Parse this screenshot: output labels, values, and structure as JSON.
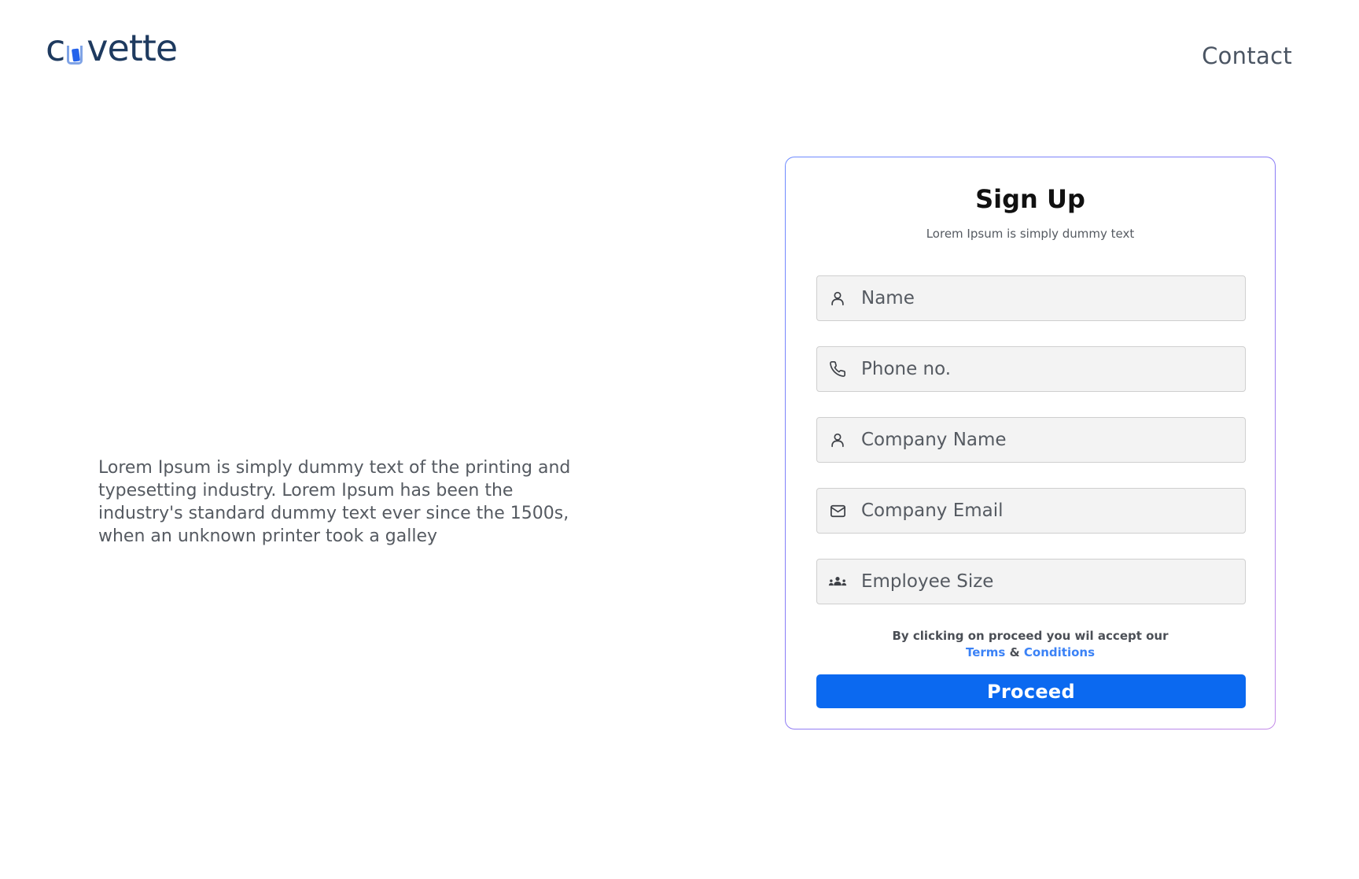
{
  "header": {
    "logo": {
      "prefix": "c",
      "suffix": "vette"
    },
    "nav_contact": "Contact"
  },
  "intro": {
    "text": "Lorem Ipsum is simply dummy text of the printing and typesetting industry. Lorem Ipsum has been the industry's standard dummy text ever since the 1500s, when an unknown printer took a galley"
  },
  "signup": {
    "title": "Sign Up",
    "subtitle": "Lorem Ipsum is simply dummy text",
    "fields": [
      {
        "placeholder": "Name",
        "icon": "user-icon"
      },
      {
        "placeholder": "Phone no.",
        "icon": "phone-icon"
      },
      {
        "placeholder": "Company Name",
        "icon": "user-icon"
      },
      {
        "placeholder": "Company Email",
        "icon": "mail-icon"
      },
      {
        "placeholder": "Employee Size",
        "icon": "group-icon"
      }
    ],
    "terms_text": "By clicking on proceed you wil accept our",
    "terms_link": "Terms",
    "ampersand": "&",
    "conditions_link": "Conditions",
    "proceed_label": "Proceed"
  },
  "colors": {
    "primary": "#0b69f0",
    "link": "#3b82f6",
    "logo_text": "#1e3a5f",
    "field_bg": "#f3f3f3"
  }
}
